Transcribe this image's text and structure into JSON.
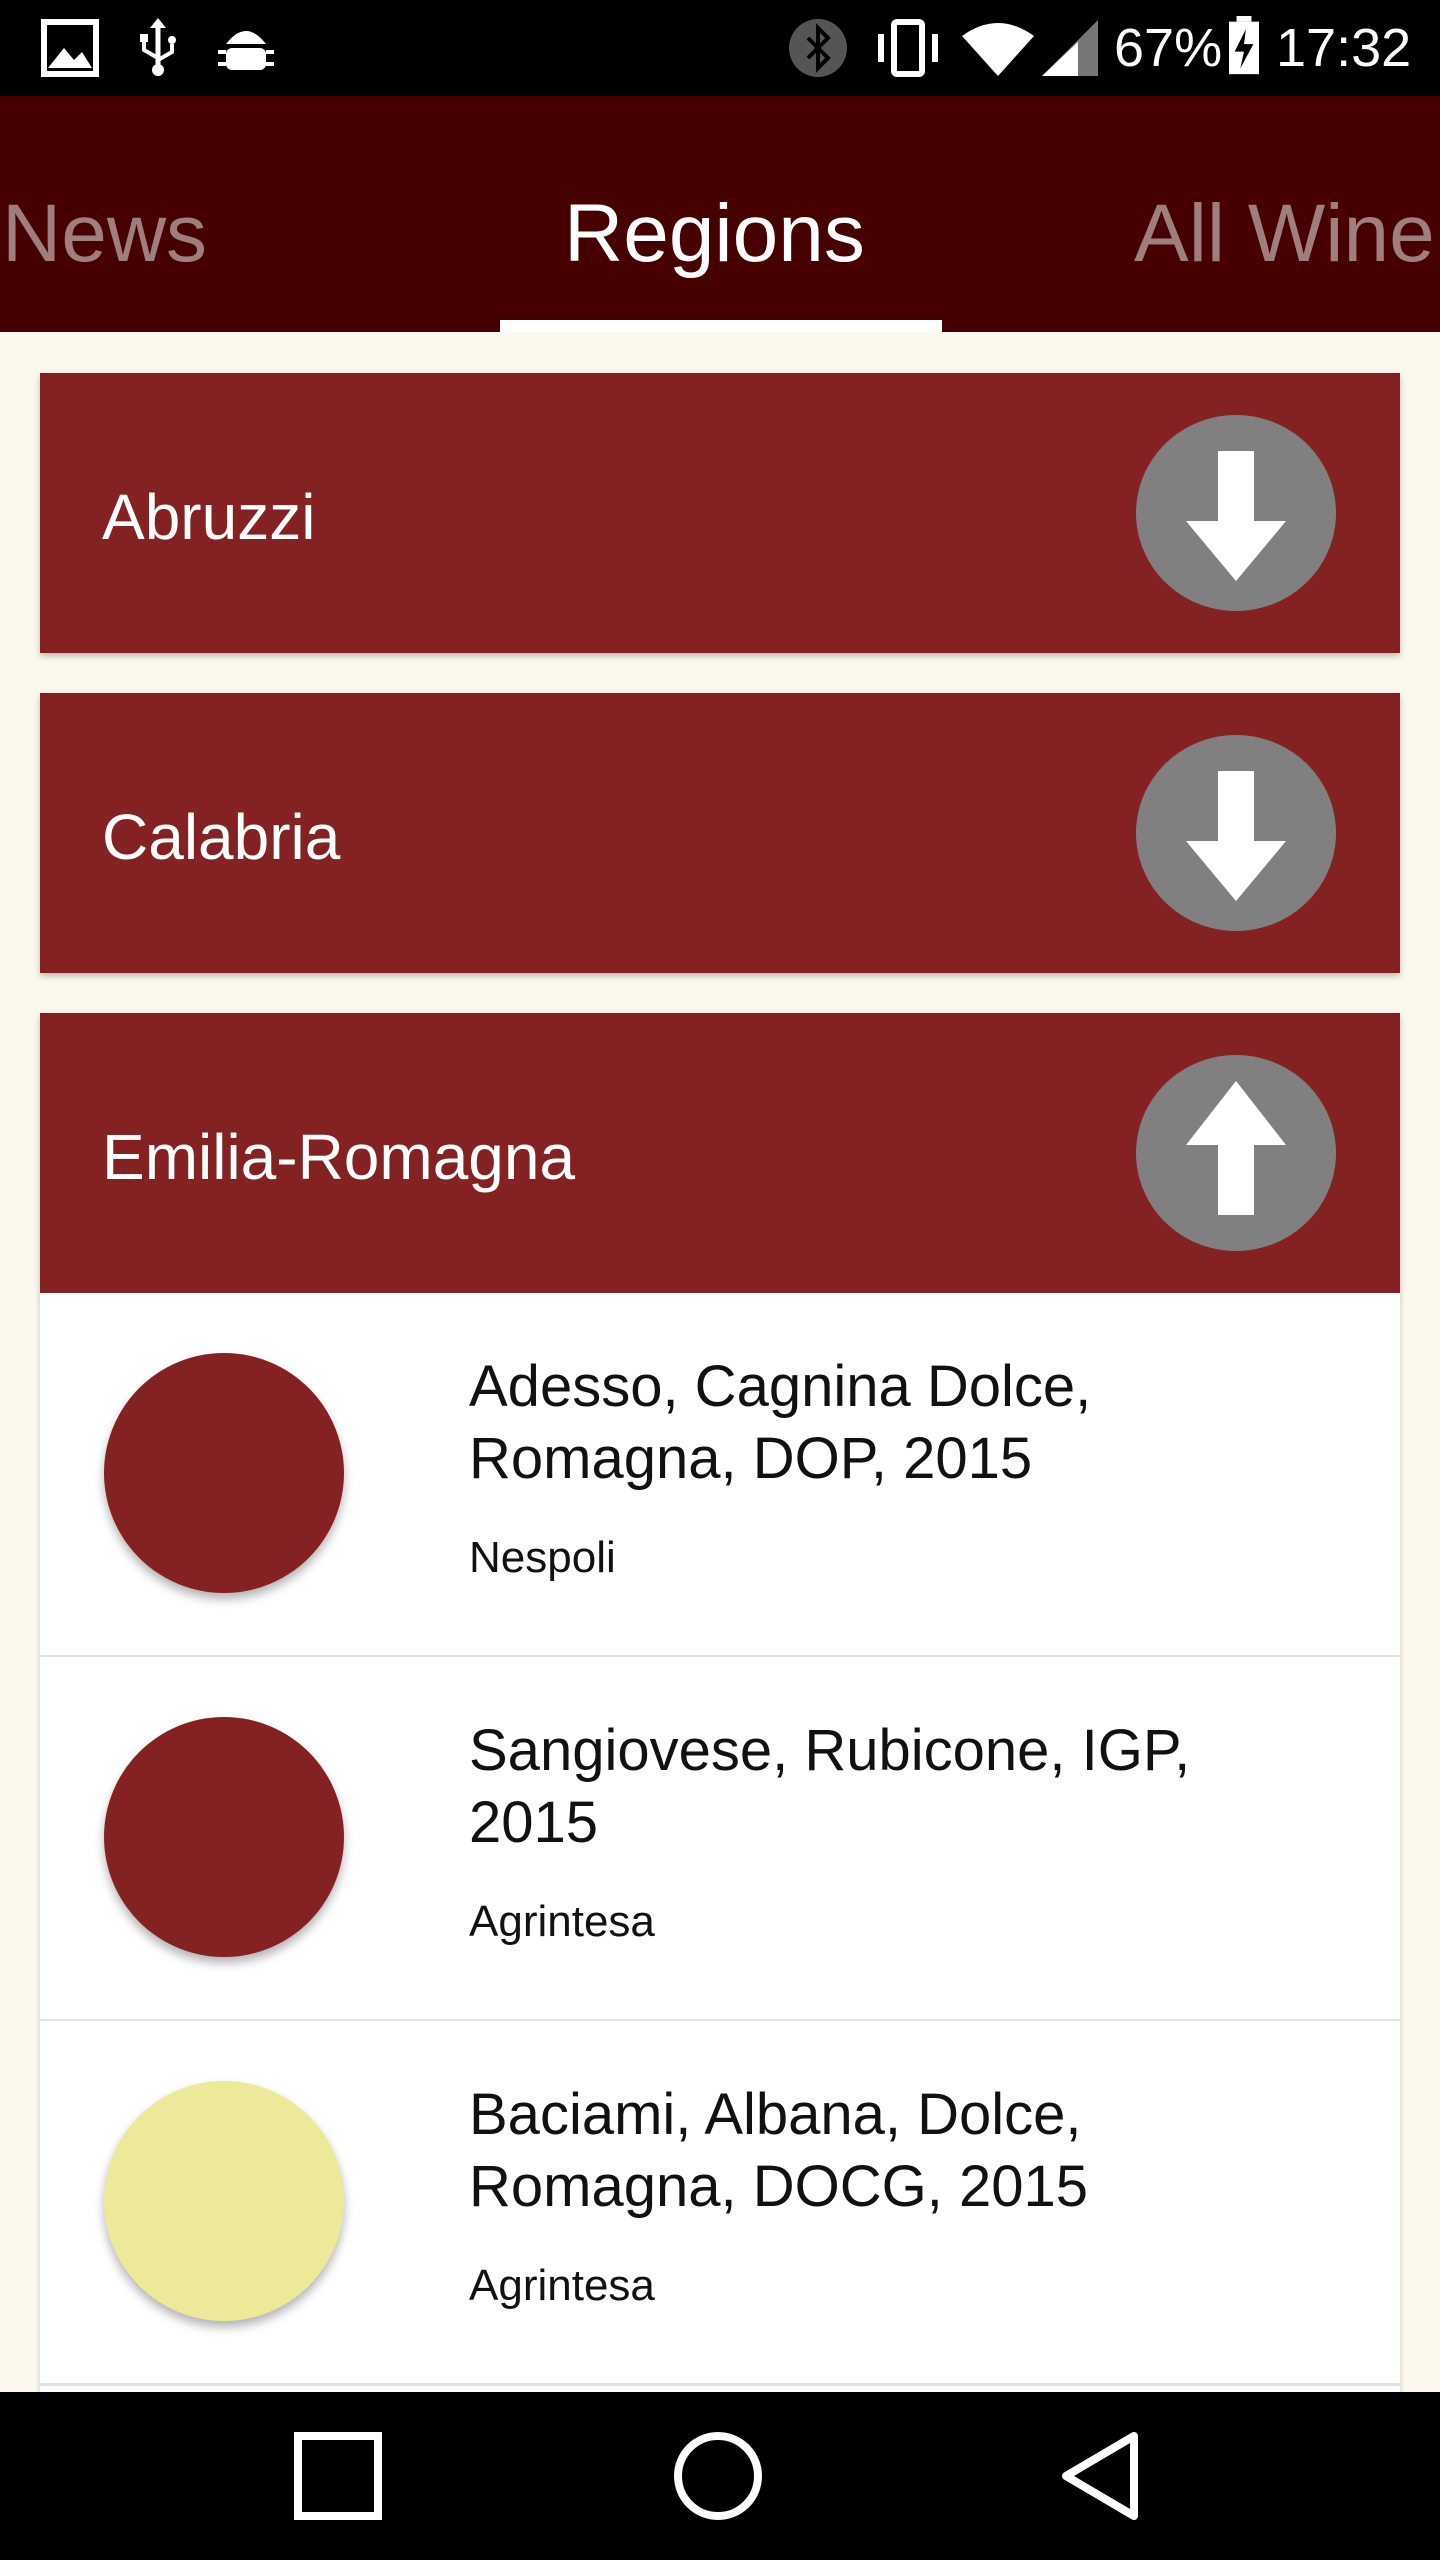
{
  "status_bar": {
    "battery_percent": "67%",
    "time": "17:32",
    "left_icons": [
      "image-icon",
      "usb-icon",
      "android-debug-icon"
    ],
    "right_icons": [
      "bluetooth-icon",
      "vibrate-icon",
      "wifi-icon",
      "signal-icon",
      "battery-charging-icon"
    ]
  },
  "tabs": [
    {
      "label": "News",
      "active": false
    },
    {
      "label": "Regions",
      "active": true
    },
    {
      "label": "All Wine",
      "active": false
    }
  ],
  "regions": [
    {
      "name": "Abruzzi",
      "expanded": false,
      "toggle_icon": "arrow-down-icon"
    },
    {
      "name": "Calabria",
      "expanded": false,
      "toggle_icon": "arrow-down-icon"
    },
    {
      "name": "Emilia-Romagna",
      "expanded": true,
      "toggle_icon": "arrow-up-icon"
    }
  ],
  "wines": [
    {
      "name": "Adesso, Cagnina Dolce, Romagna, DOP, 2015",
      "producer": "Nespoli",
      "color": "#842223"
    },
    {
      "name": "Sangiovese, Rubicone, IGP, 2015",
      "producer": "Agrintesa",
      "color": "#842223"
    },
    {
      "name": "Baciami, Albana, Dolce, Romagna, DOCG, 2015",
      "producer": "Agrintesa",
      "color": "#ecea98"
    }
  ],
  "colors": {
    "tab_bar": "#460001",
    "region_header": "#842223",
    "toggle_button": "#808080",
    "page_background": "#fdf8ee"
  },
  "nav_bar": {
    "buttons": [
      "recents-square-icon",
      "home-circle-icon",
      "back-triangle-icon"
    ]
  }
}
